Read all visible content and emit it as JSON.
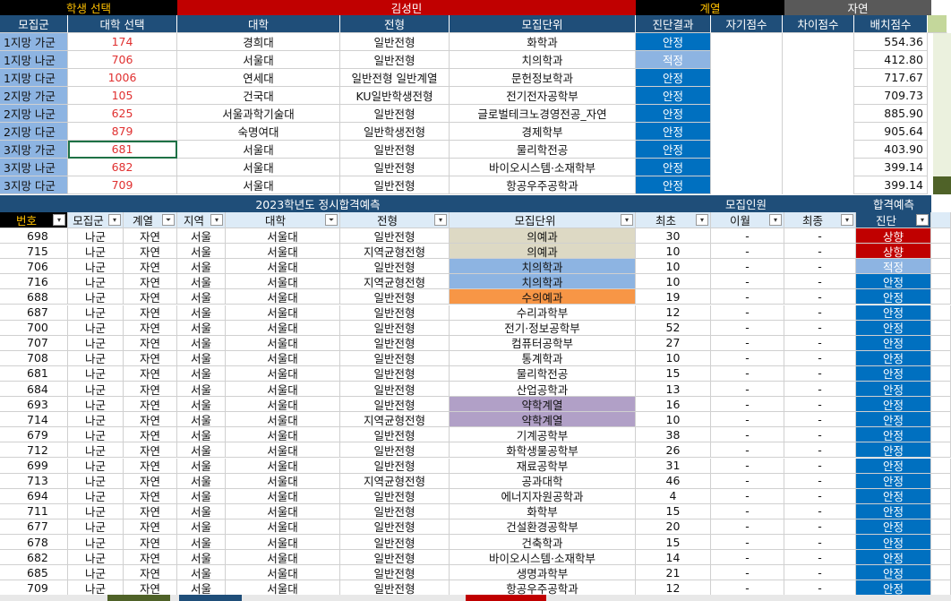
{
  "colors": {
    "dark_blue": "#1f4e79",
    "gold": "#ffc000",
    "red_banner": "#c00000",
    "stable": "#0070c0",
    "adequate": "#8db4e2",
    "rise": "#c00000",
    "beige": "#ddd9c4",
    "lav": "#b1a0c7",
    "orange": "#f79646",
    "light_blue": "#8db4e2",
    "green_side": "#c4d79b"
  },
  "banner": {
    "student_select": "학생 선택",
    "student_name": "김성민",
    "track_label": "계열",
    "track_value": "자연"
  },
  "sum_headers": [
    "모집군",
    "대학 선택",
    "대학",
    "전형",
    "모집단위",
    "진단결과",
    "자기점수",
    "차이점수",
    "배치점수"
  ],
  "summary": [
    {
      "group": "1지망 가군",
      "code": "174",
      "univ": "경희대",
      "type": "일반전형",
      "dept": "화학과",
      "diag": "안정",
      "score": "554.36"
    },
    {
      "group": "1지망 나군",
      "code": "706",
      "univ": "서울대",
      "type": "일반전형",
      "dept": "치의학과",
      "diag": "적정",
      "score": "412.80"
    },
    {
      "group": "1지망 다군",
      "code": "1006",
      "univ": "연세대",
      "type": "일반전형 일반계열",
      "dept": "문헌정보학과",
      "diag": "안정",
      "score": "717.67"
    },
    {
      "group": "2지망 가군",
      "code": "105",
      "univ": "건국대",
      "type": "KU일반학생전형",
      "dept": "전기전자공학부",
      "diag": "안정",
      "score": "709.73"
    },
    {
      "group": "2지망 나군",
      "code": "625",
      "univ": "서울과학기술대",
      "type": "일반전형",
      "dept": "글로벌테크노경영전공_자연",
      "diag": "안정",
      "score": "885.90"
    },
    {
      "group": "2지망 다군",
      "code": "879",
      "univ": "숙명여대",
      "type": "일반학생전형",
      "dept": "경제학부",
      "diag": "안정",
      "score": "905.64"
    },
    {
      "group": "3지망 가군",
      "code": "681",
      "univ": "서울대",
      "type": "일반전형",
      "dept": "물리학전공",
      "diag": "안정",
      "score": "403.90"
    },
    {
      "group": "3지망 나군",
      "code": "682",
      "univ": "서울대",
      "type": "일반전형",
      "dept": "바이오시스템·소재학부",
      "diag": "안정",
      "score": "399.14"
    },
    {
      "group": "3지망 다군",
      "code": "709",
      "univ": "서울대",
      "type": "일반전형",
      "dept": "항공우주공학과",
      "diag": "안정",
      "score": "399.14"
    }
  ],
  "section": {
    "title": "2023학년도 정시합격예측",
    "recruit_title": "모집인원",
    "predict_title": "합격예측"
  },
  "list_headers": [
    "번호",
    "모집군",
    "계열",
    "지역",
    "대학",
    "전형",
    "모집단위",
    "최초",
    "이월",
    "최종",
    "진단"
  ],
  "rows": [
    {
      "no": "698",
      "grp": "나군",
      "track": "자연",
      "region": "서울",
      "univ": "서울대",
      "type": "일반전형",
      "dept": "의예과",
      "first": "30",
      "carry": "-",
      "final": "-",
      "diag": "상향",
      "dcolor": "beige"
    },
    {
      "no": "715",
      "grp": "나군",
      "track": "자연",
      "region": "서울",
      "univ": "서울대",
      "type": "지역균형전형",
      "dept": "의예과",
      "first": "10",
      "carry": "-",
      "final": "-",
      "diag": "상향",
      "dcolor": "beige"
    },
    {
      "no": "706",
      "grp": "나군",
      "track": "자연",
      "region": "서울",
      "univ": "서울대",
      "type": "일반전형",
      "dept": "치의학과",
      "first": "10",
      "carry": "-",
      "final": "-",
      "diag": "적정",
      "dcolor": "light_blue"
    },
    {
      "no": "716",
      "grp": "나군",
      "track": "자연",
      "region": "서울",
      "univ": "서울대",
      "type": "지역균형전형",
      "dept": "치의학과",
      "first": "10",
      "carry": "-",
      "final": "-",
      "diag": "안정",
      "dcolor": "light_blue"
    },
    {
      "no": "688",
      "grp": "나군",
      "track": "자연",
      "region": "서울",
      "univ": "서울대",
      "type": "일반전형",
      "dept": "수의예과",
      "first": "19",
      "carry": "-",
      "final": "-",
      "diag": "안정",
      "dcolor": "orange"
    },
    {
      "no": "687",
      "grp": "나군",
      "track": "자연",
      "region": "서울",
      "univ": "서울대",
      "type": "일반전형",
      "dept": "수리과학부",
      "first": "12",
      "carry": "-",
      "final": "-",
      "diag": "안정",
      "dcolor": ""
    },
    {
      "no": "700",
      "grp": "나군",
      "track": "자연",
      "region": "서울",
      "univ": "서울대",
      "type": "일반전형",
      "dept": "전기·정보공학부",
      "first": "52",
      "carry": "-",
      "final": "-",
      "diag": "안정",
      "dcolor": ""
    },
    {
      "no": "707",
      "grp": "나군",
      "track": "자연",
      "region": "서울",
      "univ": "서울대",
      "type": "일반전형",
      "dept": "컴퓨터공학부",
      "first": "27",
      "carry": "-",
      "final": "-",
      "diag": "안정",
      "dcolor": ""
    },
    {
      "no": "708",
      "grp": "나군",
      "track": "자연",
      "region": "서울",
      "univ": "서울대",
      "type": "일반전형",
      "dept": "통계학과",
      "first": "10",
      "carry": "-",
      "final": "-",
      "diag": "안정",
      "dcolor": ""
    },
    {
      "no": "681",
      "grp": "나군",
      "track": "자연",
      "region": "서울",
      "univ": "서울대",
      "type": "일반전형",
      "dept": "물리학전공",
      "first": "15",
      "carry": "-",
      "final": "-",
      "diag": "안정",
      "dcolor": ""
    },
    {
      "no": "684",
      "grp": "나군",
      "track": "자연",
      "region": "서울",
      "univ": "서울대",
      "type": "일반전형",
      "dept": "산업공학과",
      "first": "13",
      "carry": "-",
      "final": "-",
      "diag": "안정",
      "dcolor": ""
    },
    {
      "no": "693",
      "grp": "나군",
      "track": "자연",
      "region": "서울",
      "univ": "서울대",
      "type": "일반전형",
      "dept": "약학계열",
      "first": "16",
      "carry": "-",
      "final": "-",
      "diag": "안정",
      "dcolor": "lav"
    },
    {
      "no": "714",
      "grp": "나군",
      "track": "자연",
      "region": "서울",
      "univ": "서울대",
      "type": "지역균형전형",
      "dept": "약학계열",
      "first": "10",
      "carry": "-",
      "final": "-",
      "diag": "안정",
      "dcolor": "lav"
    },
    {
      "no": "679",
      "grp": "나군",
      "track": "자연",
      "region": "서울",
      "univ": "서울대",
      "type": "일반전형",
      "dept": "기계공학부",
      "first": "38",
      "carry": "-",
      "final": "-",
      "diag": "안정",
      "dcolor": ""
    },
    {
      "no": "712",
      "grp": "나군",
      "track": "자연",
      "region": "서울",
      "univ": "서울대",
      "type": "일반전형",
      "dept": "화학생물공학부",
      "first": "26",
      "carry": "-",
      "final": "-",
      "diag": "안정",
      "dcolor": ""
    },
    {
      "no": "699",
      "grp": "나군",
      "track": "자연",
      "region": "서울",
      "univ": "서울대",
      "type": "일반전형",
      "dept": "재료공학부",
      "first": "31",
      "carry": "-",
      "final": "-",
      "diag": "안정",
      "dcolor": ""
    },
    {
      "no": "713",
      "grp": "나군",
      "track": "자연",
      "region": "서울",
      "univ": "서울대",
      "type": "지역균형전형",
      "dept": "공과대학",
      "first": "46",
      "carry": "-",
      "final": "-",
      "diag": "안정",
      "dcolor": ""
    },
    {
      "no": "694",
      "grp": "나군",
      "track": "자연",
      "region": "서울",
      "univ": "서울대",
      "type": "일반전형",
      "dept": "에너지자원공학과",
      "first": "4",
      "carry": "-",
      "final": "-",
      "diag": "안정",
      "dcolor": ""
    },
    {
      "no": "711",
      "grp": "나군",
      "track": "자연",
      "region": "서울",
      "univ": "서울대",
      "type": "일반전형",
      "dept": "화학부",
      "first": "15",
      "carry": "-",
      "final": "-",
      "diag": "안정",
      "dcolor": ""
    },
    {
      "no": "677",
      "grp": "나군",
      "track": "자연",
      "region": "서울",
      "univ": "서울대",
      "type": "일반전형",
      "dept": "건설환경공학부",
      "first": "20",
      "carry": "-",
      "final": "-",
      "diag": "안정",
      "dcolor": ""
    },
    {
      "no": "678",
      "grp": "나군",
      "track": "자연",
      "region": "서울",
      "univ": "서울대",
      "type": "일반전형",
      "dept": "건축학과",
      "first": "15",
      "carry": "-",
      "final": "-",
      "diag": "안정",
      "dcolor": ""
    },
    {
      "no": "682",
      "grp": "나군",
      "track": "자연",
      "region": "서울",
      "univ": "서울대",
      "type": "일반전형",
      "dept": "바이오시스템·소재학부",
      "first": "14",
      "carry": "-",
      "final": "-",
      "diag": "안정",
      "dcolor": ""
    },
    {
      "no": "685",
      "grp": "나군",
      "track": "자연",
      "region": "서울",
      "univ": "서울대",
      "type": "일반전형",
      "dept": "생명과학부",
      "first": "21",
      "carry": "-",
      "final": "-",
      "diag": "안정",
      "dcolor": ""
    },
    {
      "no": "709",
      "grp": "나군",
      "track": "자연",
      "region": "서울",
      "univ": "서울대",
      "type": "일반전형",
      "dept": "항공우주공학과",
      "first": "12",
      "carry": "-",
      "final": "-",
      "diag": "안정",
      "dcolor": ""
    }
  ]
}
